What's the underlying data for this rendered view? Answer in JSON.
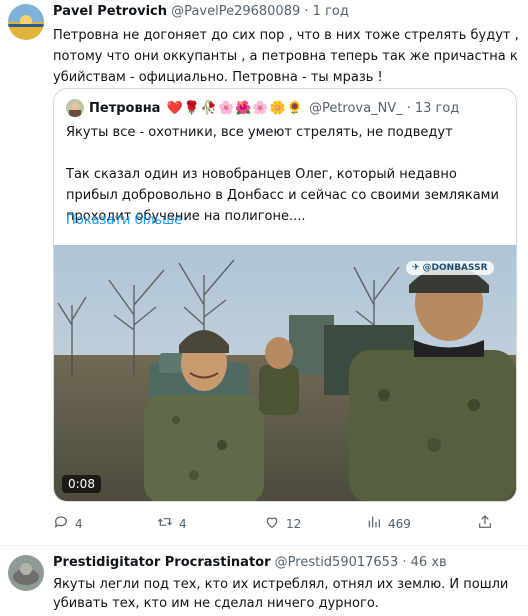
{
  "tweet": {
    "author_name": "Pavel Petrovich",
    "handle": "@PavelPe29680089",
    "separator": "·",
    "time": "1 год",
    "text": "Петровна не догоняет до сих пор , что в них тоже стрелять будут , потому что они оккупанты , а петровна теперь так же причастна к убийствам - официально. Петровна - ты мразь !"
  },
  "quote": {
    "author_name": "Петровна",
    "emojis": "❤️🌹🥀🌸🌺🌸🌼🌻",
    "handle": "@Petrova_NV_",
    "separator": "·",
    "time": "13 год",
    "line1": "Якуты все - охотники, все умеют стрелять, не подведут",
    "line2": "Так сказал один из новобранцев Олег, который недавно прибыл добровольно в Донбасс и сейчас со своими земляками проходит обучение на полигоне....",
    "show_more": "Показати більше",
    "video": {
      "duration": "0:08",
      "watermark": "@DONBASSR"
    }
  },
  "actions": {
    "replies": "4",
    "retweets": "4",
    "likes": "12",
    "views": "469"
  },
  "reply": {
    "author_name": "Prestidigitator Procrastinator",
    "handle": "@Prestid59017653",
    "separator": "·",
    "time": "46 хв",
    "text": "Якуты легли под тех, кто их истреблял, отнял их землю. И пошли убивать тех, кто им не сделал ничего дурного."
  }
}
